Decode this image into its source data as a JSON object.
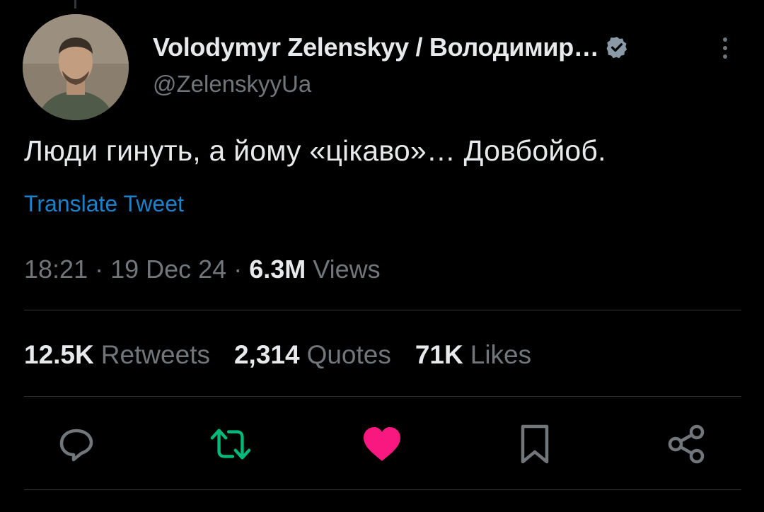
{
  "tweet": {
    "display_name": "Volodymyr Zelenskyy / Володимир…",
    "handle": "@ZelenskyyUa",
    "verified_icon": "verified-badge-icon",
    "text": "Люди гинуть, а йому «цікаво»… Довбойоб.",
    "translate_label": "Translate Tweet",
    "time": "18:21",
    "date": "19 Dec 24",
    "views_count": "6.3M",
    "views_label": "Views",
    "separator": " · "
  },
  "stats": {
    "retweets_count": "12.5K",
    "retweets_label": "Retweets",
    "quotes_count": "2,314",
    "quotes_label": "Quotes",
    "likes_count": "71K",
    "likes_label": "Likes"
  },
  "actions": {
    "icons": [
      "reply-icon",
      "retweet-icon",
      "like-icon",
      "bookmark-icon",
      "share-icon"
    ],
    "retweet_color": "#00ba7c",
    "like_color": "#f91880",
    "icon_color": "#71767b"
  },
  "colors": {
    "background": "#000000",
    "link": "#1d9bf0",
    "text": "#e7e9ea",
    "muted": "#71767b"
  }
}
